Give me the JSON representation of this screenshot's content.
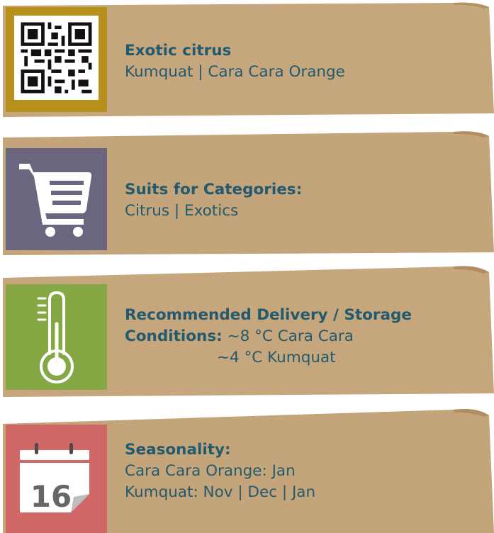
{
  "colors": {
    "paper": "#c4a47a",
    "text": "#235a6e",
    "tile_qr": "#b7901c",
    "tile_cart": "#6a6680",
    "tile_thermo": "#86a844",
    "tile_calendar": "#d16868"
  },
  "cards": [
    {
      "icon": "qr-code-icon",
      "title": "Exotic citrus",
      "lines": [
        "Kumquat | Cara Cara Orange"
      ]
    },
    {
      "icon": "shopping-cart-icon",
      "title": "Suits for Categories:",
      "lines": [
        "Citrus | Exotics"
      ]
    },
    {
      "icon": "thermometer-icon",
      "title": "Recommended Delivery / Storage",
      "title2": "Conditions:",
      "lines": [
        "~8 °C Cara Cara",
        "~4 °C Kumquat"
      ]
    },
    {
      "icon": "calendar-icon",
      "calendar_day": "16",
      "title": "Seasonality:",
      "lines": [
        "Cara Cara Orange: Jan",
        "Kumquat: Nov | Dec | Jan"
      ]
    }
  ]
}
